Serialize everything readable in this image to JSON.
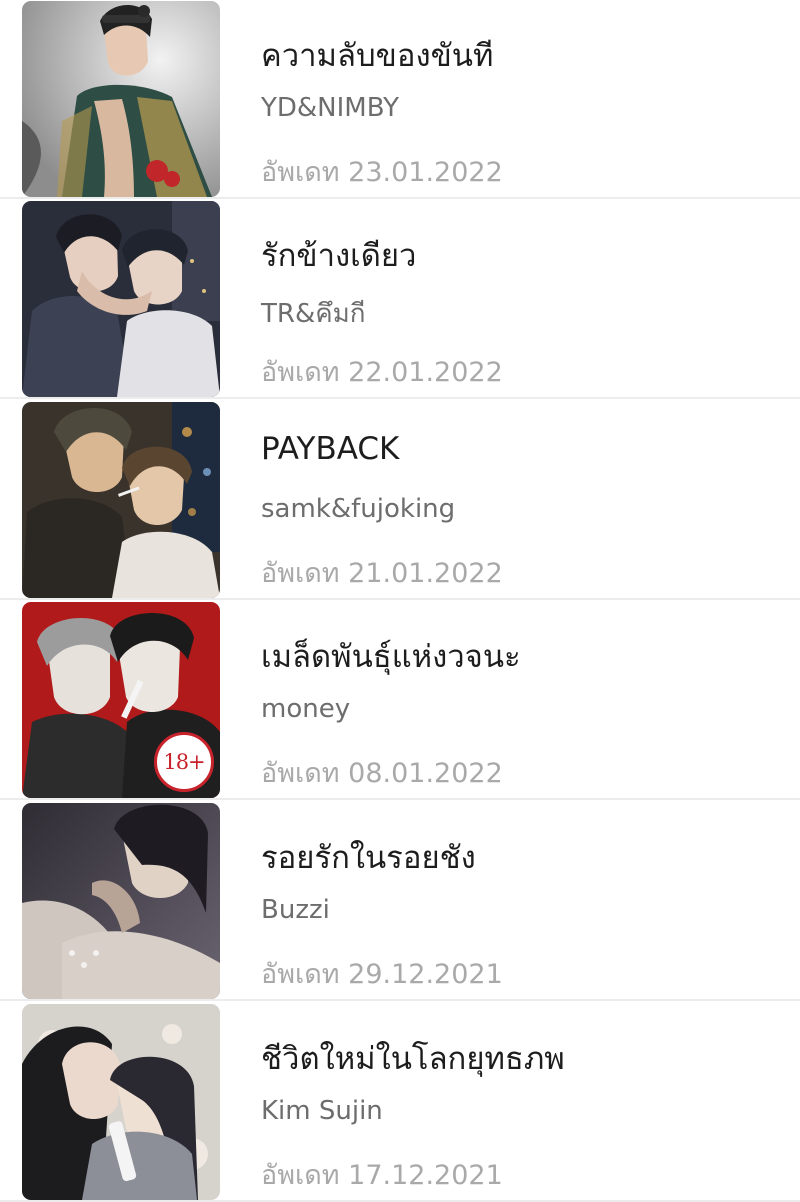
{
  "items": [
    {
      "title": "ความลับของขันที",
      "author": "YD&NIMBY",
      "updated": "อัพเดท 23.01.2022",
      "cover_icon": "cover-illustration",
      "cover_colors": [
        "#e4e4e4",
        "#555555",
        "#2d4d45",
        "#b49a4f"
      ]
    },
    {
      "title": "รักข้างเดียว",
      "author": "TR&คึมกี",
      "updated": "อัพเดท 22.01.2022",
      "cover_icon": "cover-illustration",
      "cover_colors": [
        "#2a2d3a",
        "#3c4254",
        "#20242e",
        "#e2d2c6"
      ]
    },
    {
      "title": "PAYBACK",
      "author": "samk&fujoking",
      "updated": "อัพเดท 21.01.2022",
      "cover_icon": "cover-illustration",
      "cover_colors": [
        "#3a332b",
        "#4d4a3d",
        "#2b2823",
        "#d9b793"
      ]
    },
    {
      "title": "เมล็ดพันธุ์แห่งวจนะ",
      "author": "money",
      "updated": "อัพเดท 08.01.2022",
      "cover_icon": "cover-illustration",
      "cover_colors": [
        "#b11a1a",
        "#2c2c2c",
        "#9c9c9c",
        "#e7e1dc"
      ],
      "badge": "18+"
    },
    {
      "title": "รอยรักในรอยชัง",
      "author": "Buzzi",
      "updated": "อัพเดท 29.12.2021",
      "cover_icon": "cover-illustration",
      "cover_colors": [
        "#2f2c34",
        "#6b6572",
        "#1e1b22",
        "#d8cfc8"
      ]
    },
    {
      "title": "ชีวิตใหม่ในโลกยุทธภพ",
      "author": "Kim Sujin",
      "updated": "อัพเดท 17.12.2021",
      "cover_icon": "cover-illustration",
      "cover_colors": [
        "#d6d3cd",
        "#1c1b1e",
        "#8c8f98",
        "#efe9e1"
      ]
    }
  ]
}
